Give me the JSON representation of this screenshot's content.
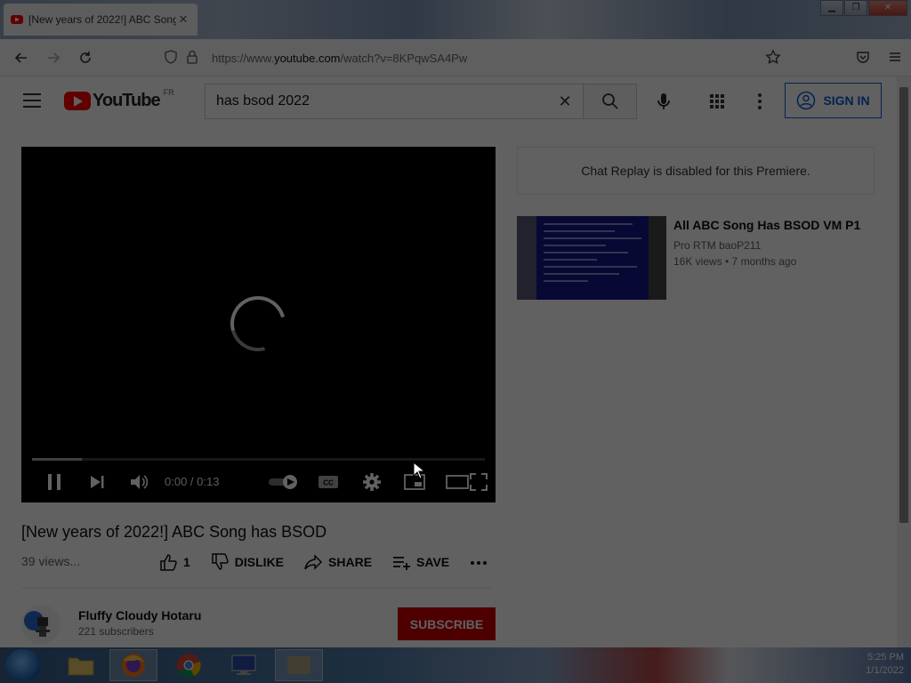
{
  "browser": {
    "tab_title": "[New years of 2022!] ABC Song has BSOD",
    "tab_close": "✕",
    "url_host": "https://www.",
    "url_domain": "youtube.com",
    "url_path": "/watch?v=8KPqwSA4Pw"
  },
  "header": {
    "logo_text": "YouTube",
    "country_code": "FR",
    "search_query": "has bsod 2022",
    "sign_in_label": "SIGN IN"
  },
  "video": {
    "time": "0:00 / 0:13",
    "buffered_fraction": 0.11,
    "title": "[New years of 2022!] ABC Song has BSOD",
    "views": "39 views...",
    "like_count": "1",
    "dislike_label": "DISLIKE",
    "share_label": "SHARE",
    "save_label": "SAVE"
  },
  "channel": {
    "name": "Fluffy Cloudy Hotaru",
    "subscribers": "221 subscribers",
    "subscribe_label": "SUBSCRIBE"
  },
  "sidebar": {
    "chat_replay": "Chat Replay is disabled for this Premiere.",
    "recommendation": {
      "title": "All ABC Song Has BSOD VM P1",
      "channel": "Pro RTM baoP211",
      "meta": "16K views • 7 months ago"
    }
  },
  "taskbar": {
    "time": "5:25 PM",
    "date": "1/1/2022"
  },
  "colors": {
    "youtube_red": "#ff0000",
    "subscribe_red": "#cc0000",
    "link_blue": "#065fd4"
  }
}
